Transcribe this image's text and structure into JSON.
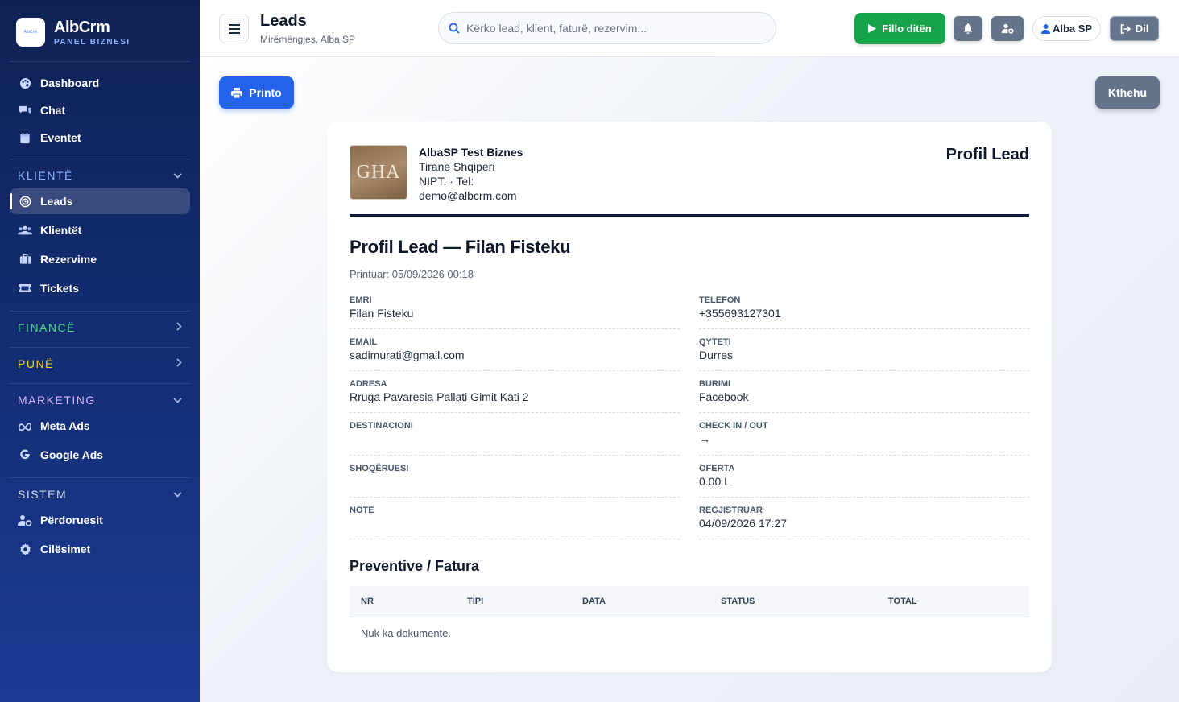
{
  "brand": {
    "name": "AlbCrm",
    "subtitle": "PANEL BIZNESI",
    "logo_text": "AlbCrm"
  },
  "sidebar": {
    "top_items": [
      {
        "label": "Dashboard",
        "icon": "palette-icon"
      },
      {
        "label": "Chat",
        "icon": "chat-icon"
      },
      {
        "label": "Eventet",
        "icon": "calendar-icon"
      }
    ],
    "sections": {
      "klientet": {
        "label": "KLIENTË",
        "color": "#8fb4ff",
        "expanded": true,
        "items": [
          {
            "label": "Leads",
            "icon": "target-icon",
            "active": true
          },
          {
            "label": "Klientët",
            "icon": "users-icon"
          },
          {
            "label": "Rezervime",
            "icon": "suitcase-icon"
          },
          {
            "label": "Tickets",
            "icon": "ticket-icon"
          }
        ]
      },
      "finance": {
        "label": "FINANCË",
        "color": "#4ade80",
        "expanded": false
      },
      "pune": {
        "label": "PUNË",
        "color": "#facc15",
        "expanded": false
      },
      "marketing": {
        "label": "MARKETING",
        "color": "#d8b4fe",
        "expanded": true,
        "items": [
          {
            "label": "Meta Ads",
            "icon": "meta-icon"
          },
          {
            "label": "Google Ads",
            "icon": "google-icon"
          }
        ]
      },
      "sistem": {
        "label": "SISTEM",
        "color": "#cbd5e1",
        "expanded": true,
        "items": [
          {
            "label": "Përdoruesit",
            "icon": "user-gear-icon"
          },
          {
            "label": "Cilësimet",
            "icon": "gear-icon"
          }
        ]
      }
    }
  },
  "header": {
    "title": "Leads",
    "subtitle": "Mirëmëngjes, Alba SP",
    "search_placeholder": "Kërko lead, klient, faturë, rezervim...",
    "start_day_label": "Fillo ditën",
    "user_label": "Alba SP",
    "logout_label": "Dil"
  },
  "actions": {
    "print_label": "Printo",
    "back_label": "Kthehu"
  },
  "document": {
    "company": {
      "name": "AlbaSP Test Biznes",
      "address": "Tirane Shqiperi",
      "nipt_tel": "NIPT: · Tel:",
      "email": "demo@albcrm.com",
      "logo_text": "GHA"
    },
    "doc_type": "Profil Lead",
    "title": "Profil Lead — Filan Fisteku",
    "printed": "Printuar: 05/09/2026 00:18",
    "fields": [
      {
        "label": "EMRI",
        "value": "Filan Fisteku"
      },
      {
        "label": "TELEFON",
        "value": "+355693127301"
      },
      {
        "label": "EMAIL",
        "value": "sadimurati@gmail.com"
      },
      {
        "label": "QYTETI",
        "value": "Durres"
      },
      {
        "label": "ADRESA",
        "value": "Rruga Pavaresia Pallati Gimit Kati 2"
      },
      {
        "label": "BURIMI",
        "value": "Facebook"
      },
      {
        "label": "DESTINACIONI",
        "value": ""
      },
      {
        "label": "CHECK IN / OUT",
        "value": "→"
      },
      {
        "label": "SHOQËRUESI",
        "value": ""
      },
      {
        "label": "OFERTA",
        "value": "0.00 L"
      },
      {
        "label": "NOTE",
        "value": ""
      },
      {
        "label": "REGJISTRUAR",
        "value": "04/09/2026 17:27"
      }
    ],
    "invoices": {
      "title": "Preventive / Fatura",
      "columns": [
        "NR",
        "TIPI",
        "DATA",
        "STATUS",
        "TOTAL"
      ],
      "empty_text": "Nuk ka dokumente."
    }
  },
  "colors": {
    "accent": "#2563eb",
    "success": "#16a34a",
    "sidebar": "#15307a",
    "neutral_button": "#64748b"
  }
}
